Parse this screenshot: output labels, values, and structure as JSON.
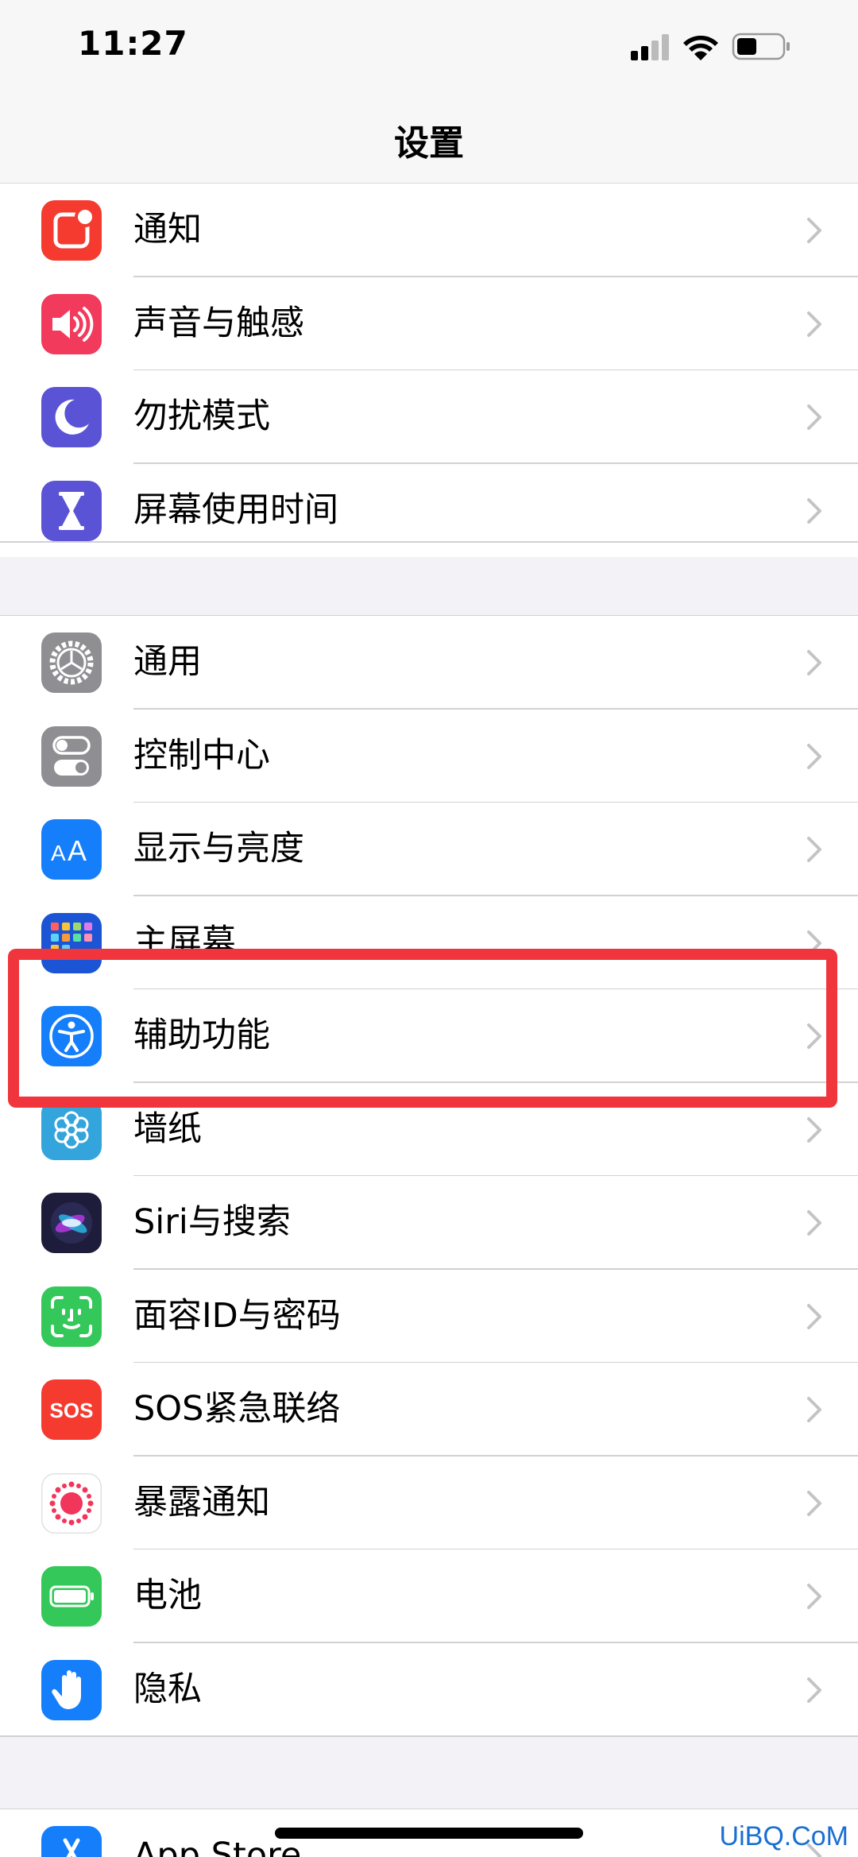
{
  "status": {
    "time": "11:27"
  },
  "nav": {
    "title": "设置"
  },
  "group1": [
    {
      "label": "通知",
      "icon": "notifications-icon",
      "color": "#f53b30"
    },
    {
      "label": "声音与触感",
      "icon": "sounds-icon",
      "color": "#f23a5c"
    },
    {
      "label": "勿扰模式",
      "icon": "moon-icon",
      "color": "#5b53d6"
    },
    {
      "label": "屏幕使用时间",
      "icon": "hourglass-icon",
      "color": "#5b53d6"
    }
  ],
  "group2": [
    {
      "label": "通用",
      "icon": "gear-icon",
      "color": "#8e8e93"
    },
    {
      "label": "控制中心",
      "icon": "toggles-icon",
      "color": "#8e8e93"
    },
    {
      "label": "显示与亮度",
      "icon": "text-size-icon",
      "color": "#147efb"
    },
    {
      "label": "主屏幕",
      "icon": "home-screen-icon",
      "color": "#1b55d6"
    },
    {
      "label": "辅助功能",
      "icon": "accessibility-icon",
      "color": "#147efb"
    },
    {
      "label": "墙纸",
      "icon": "flower-icon",
      "color": "#34a4dc"
    },
    {
      "label": "Siri与搜索",
      "icon": "siri-icon",
      "color": "#1d1d3b"
    },
    {
      "label": "面容ID与密码",
      "icon": "face-id-icon",
      "color": "#34c759"
    },
    {
      "label": "SOS紧急联络",
      "icon": "sos-icon",
      "color": "#f53b30",
      "icon_text": "SOS"
    },
    {
      "label": "暴露通知",
      "icon": "exposure-icon",
      "color": "#ffffff"
    },
    {
      "label": "电池",
      "icon": "battery-icon",
      "color": "#34c759"
    },
    {
      "label": "隐私",
      "icon": "hand-icon",
      "color": "#147efb"
    }
  ],
  "group3": [
    {
      "label": "App Store",
      "icon": "app-store-icon",
      "color": "#147efb"
    }
  ],
  "watermark": "UiBQ.CoM"
}
